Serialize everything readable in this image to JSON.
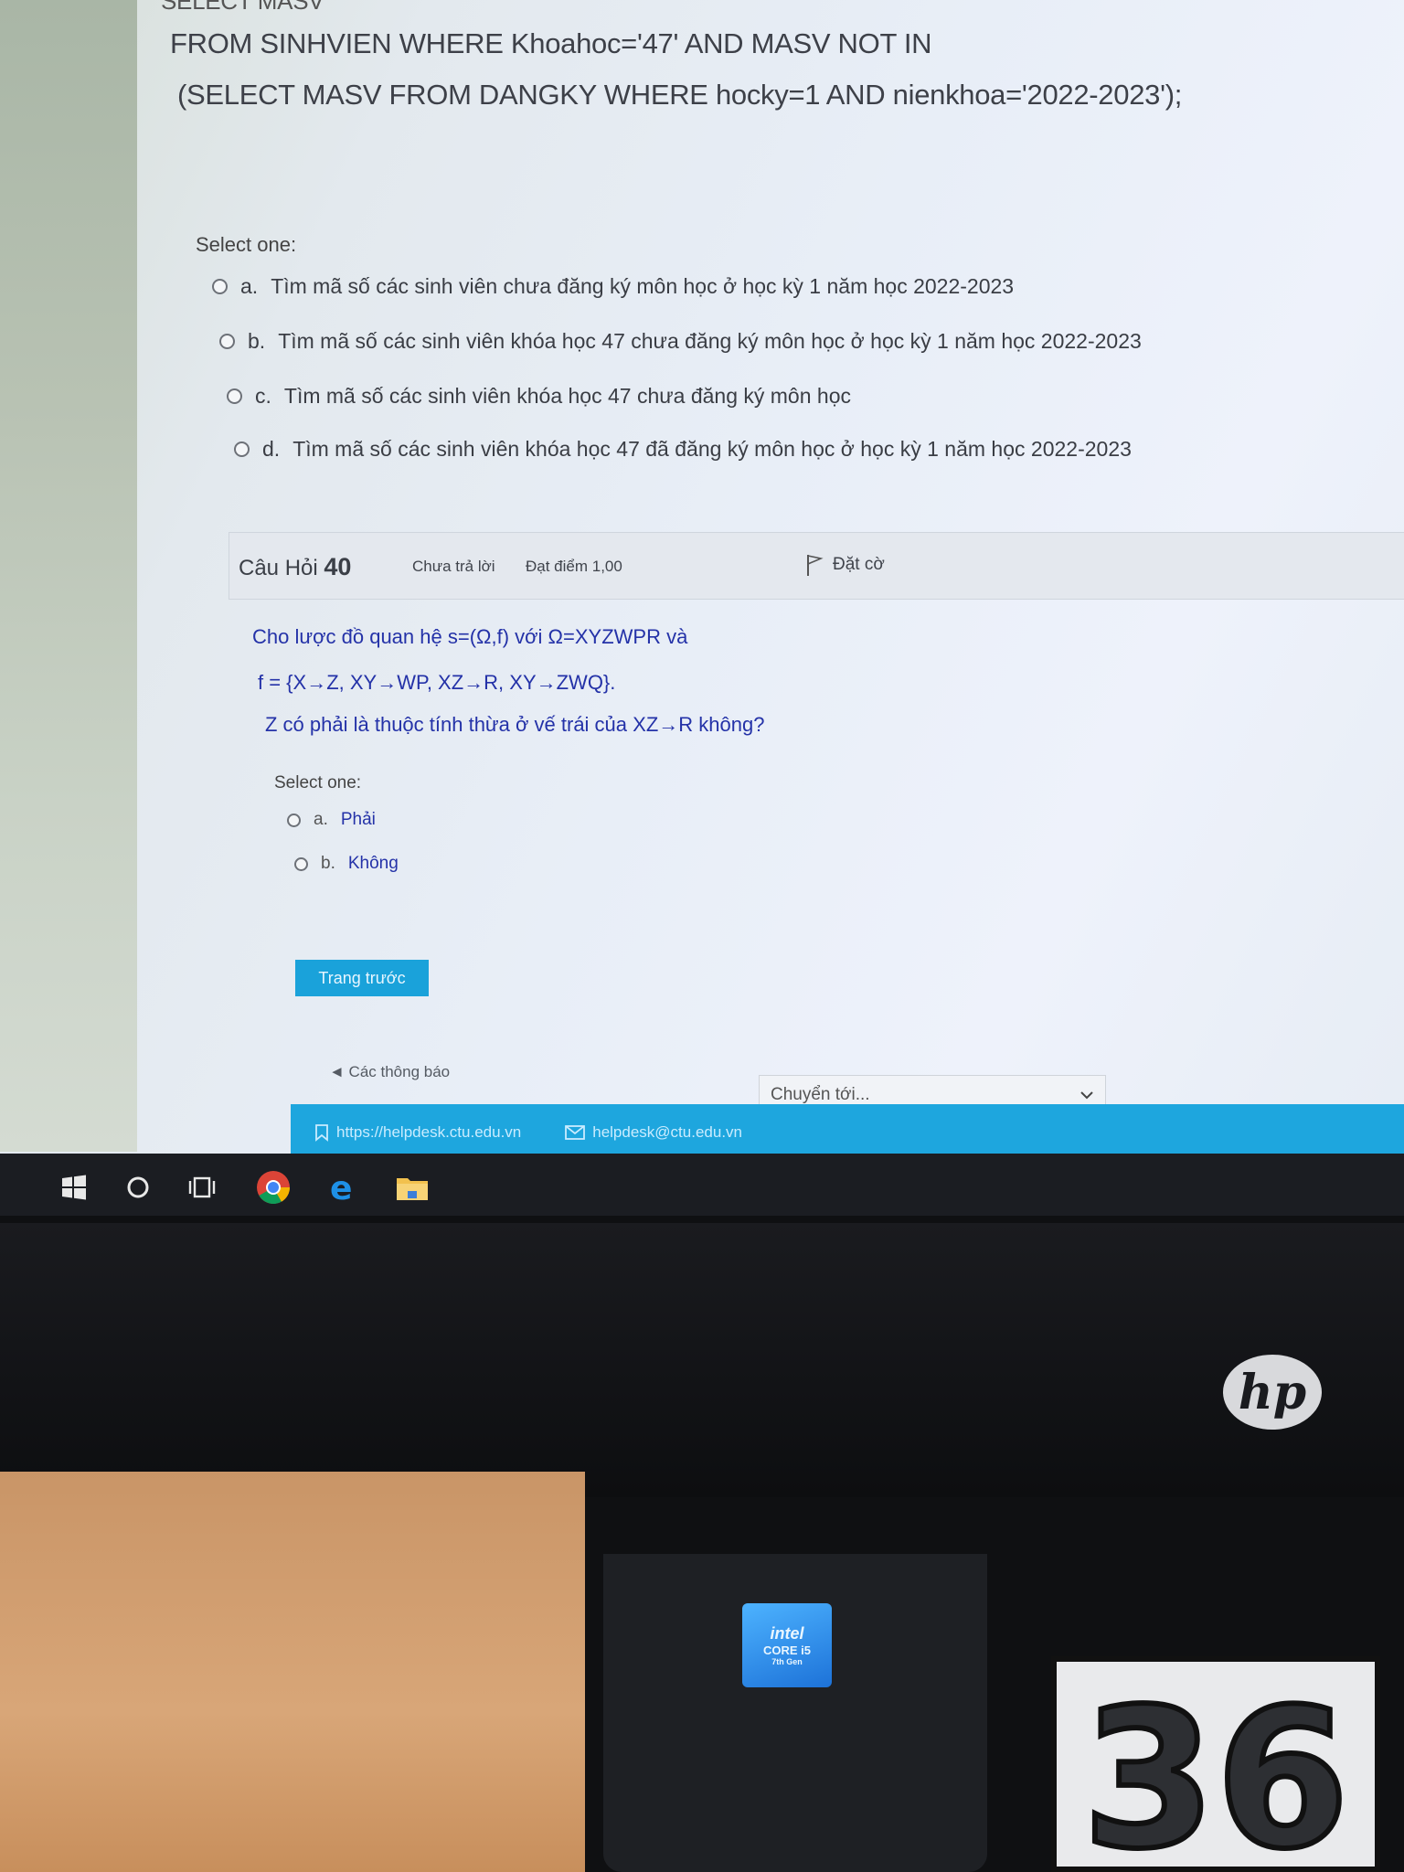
{
  "sql": {
    "line1": "SELECT MASV",
    "line2": "FROM SINHVIEN WHERE Khoahoc='47' AND MASV NOT IN",
    "line3": "(SELECT MASV FROM DANGKY WHERE hocky=1 AND nienkhoa='2022-2023');"
  },
  "question39": {
    "select_label": "Select one:",
    "options": [
      {
        "letter": "a.",
        "text": "Tìm mã số các sinh viên chưa đăng ký môn học ở học kỳ 1 năm học 2022-2023"
      },
      {
        "letter": "b.",
        "text": "Tìm mã số các sinh viên khóa học 47 chưa đăng ký môn học ở học kỳ 1 năm học 2022-2023"
      },
      {
        "letter": "c.",
        "text": "Tìm mã số các sinh viên khóa học 47 chưa đăng ký môn học"
      },
      {
        "letter": "d.",
        "text": "Tìm mã số các sinh viên khóa học 47 đã đăng ký môn học ở học kỳ 1 năm học 2022-2023"
      }
    ]
  },
  "question40": {
    "title_prefix": "Câu Hỏi",
    "number": "40",
    "status": "Chưa trả lời",
    "grade": "Đạt điểm 1,00",
    "flag_label": "Đặt cờ",
    "text_line1": "Cho lược đồ quan hệ s=(Ω,f) với Ω=XYZWPR và",
    "text_line2": "f = {X→Z, XY→WP, XZ→R, XY→ZWQ}.",
    "text_line3": "Z có phải là thuộc tính thừa ở vế trái của XZ→R không?",
    "select_label": "Select one:",
    "options": [
      {
        "letter": "a.",
        "text": "Phải"
      },
      {
        "letter": "b.",
        "text": "Không"
      }
    ]
  },
  "nav": {
    "prev_button": "Trang trước",
    "back_link": "◄ Các thông báo",
    "jump_placeholder": "Chuyển tới..."
  },
  "footer": {
    "helpdesk_url": "https://helpdesk.ctu.edu.vn",
    "helpdesk_email": "helpdesk@ctu.edu.vn"
  },
  "hardware": {
    "brand": "hp",
    "intel_brand": "intel",
    "intel_model": "CORE i5",
    "intel_gen": "7th Gen",
    "station_number": "36"
  },
  "colors": {
    "accent": "#1aa2da",
    "question_text": "#2432a8"
  }
}
